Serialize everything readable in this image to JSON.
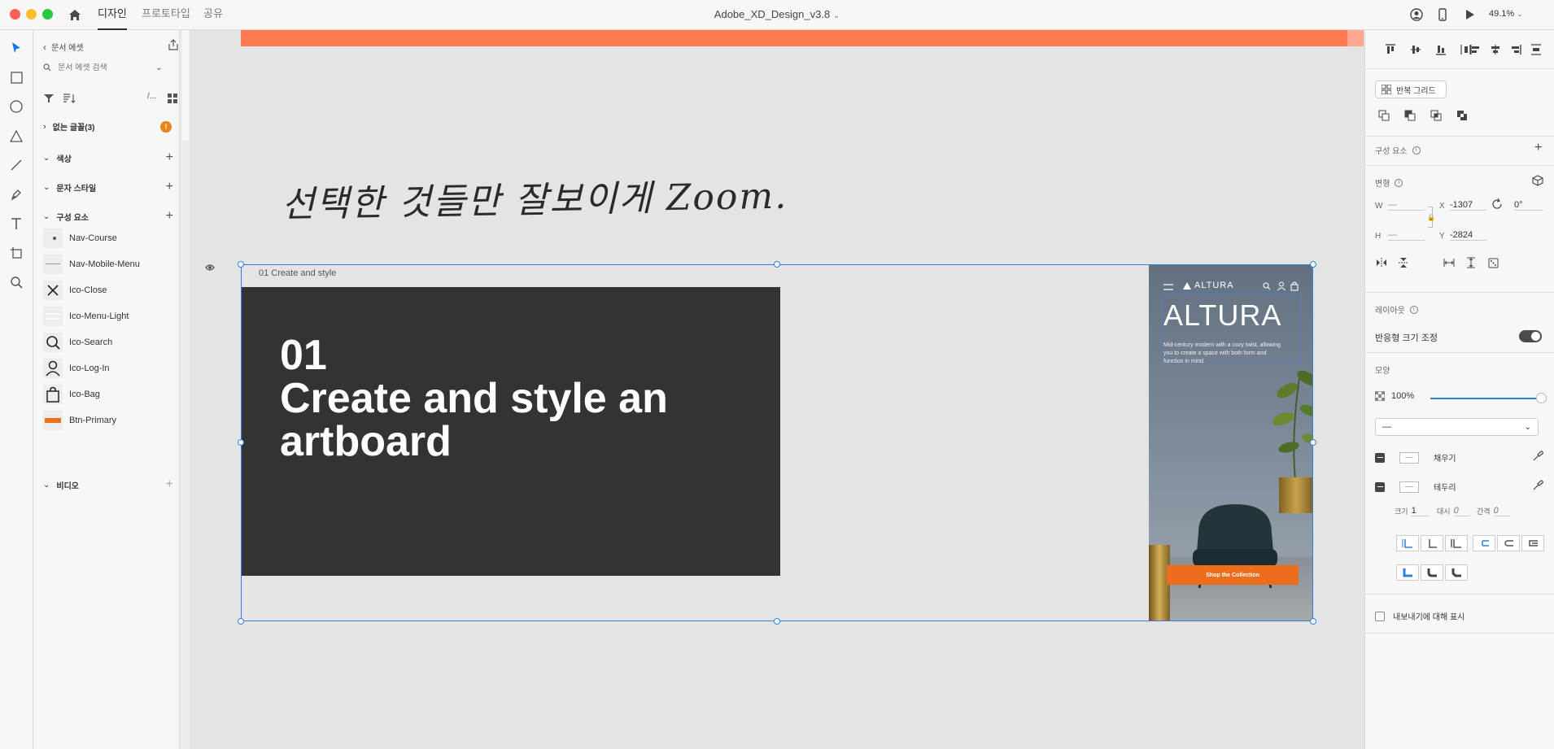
{
  "titlebar": {
    "tabs": [
      "디자인",
      "프로토타입",
      "공유"
    ],
    "document_title": "Adobe_XD_Design_v3.8",
    "zoom": "49.1%"
  },
  "assets": {
    "back_label": "문서 에셋",
    "search_placeholder": "문서 에셋 검색",
    "missing_fonts": "없는 글꼴(3)",
    "missing_fonts_badge": "!",
    "sections": {
      "colors": "색상",
      "char_styles": "문자 스타일",
      "components": "구성 요소",
      "video": "비디오"
    },
    "components": [
      "Nav-Course",
      "Nav-Mobile-Menu",
      "Ico-Close",
      "Ico-Menu-Light",
      "Ico-Search",
      "Ico-Log-In",
      "Ico-Bag",
      "Btn-Primary"
    ]
  },
  "canvas": {
    "handwriting": "선택한 것들만 잘보이게 Zoom.",
    "artboard_label": "01 Create and style",
    "hero_number": "01",
    "hero_line1": "Create and style an",
    "hero_line2": "artboard",
    "mobile": {
      "brand": "ALTURA",
      "heading": "ALTURA",
      "body": "Mid-century modern with a cozy twist, allowing you to create a space with both form and function in mind.",
      "cta": "Shop the Collection"
    }
  },
  "properties": {
    "repeat_grid": "반복 그리드",
    "component_title": "구성 요소",
    "transform_title": "변형",
    "w_label": "W",
    "w_value": "—",
    "h_label": "H",
    "h_value": "—",
    "x_label": "X",
    "x_value": "-1307",
    "y_label": "Y",
    "y_value": "-2824",
    "rotation": "0°",
    "layout_title": "레이아웃",
    "responsive_resize": "반응형 크기 조정",
    "appearance_title": "모양",
    "opacity": "100%",
    "blend_mode": "—",
    "fill_label": "채우기",
    "border_label": "테두리",
    "size_label": "크기",
    "size_value": "1",
    "dash_label": "대시",
    "dash_value": "0",
    "gap_label": "간격",
    "gap_value": "0",
    "export_label": "내보내기에 대해 표시"
  },
  "colors": {
    "accent_orange": "#ff7a50",
    "selection_blue": "#2f7fdc",
    "artboard_dark": "#333333",
    "cta_orange": "#ec6d1c"
  }
}
